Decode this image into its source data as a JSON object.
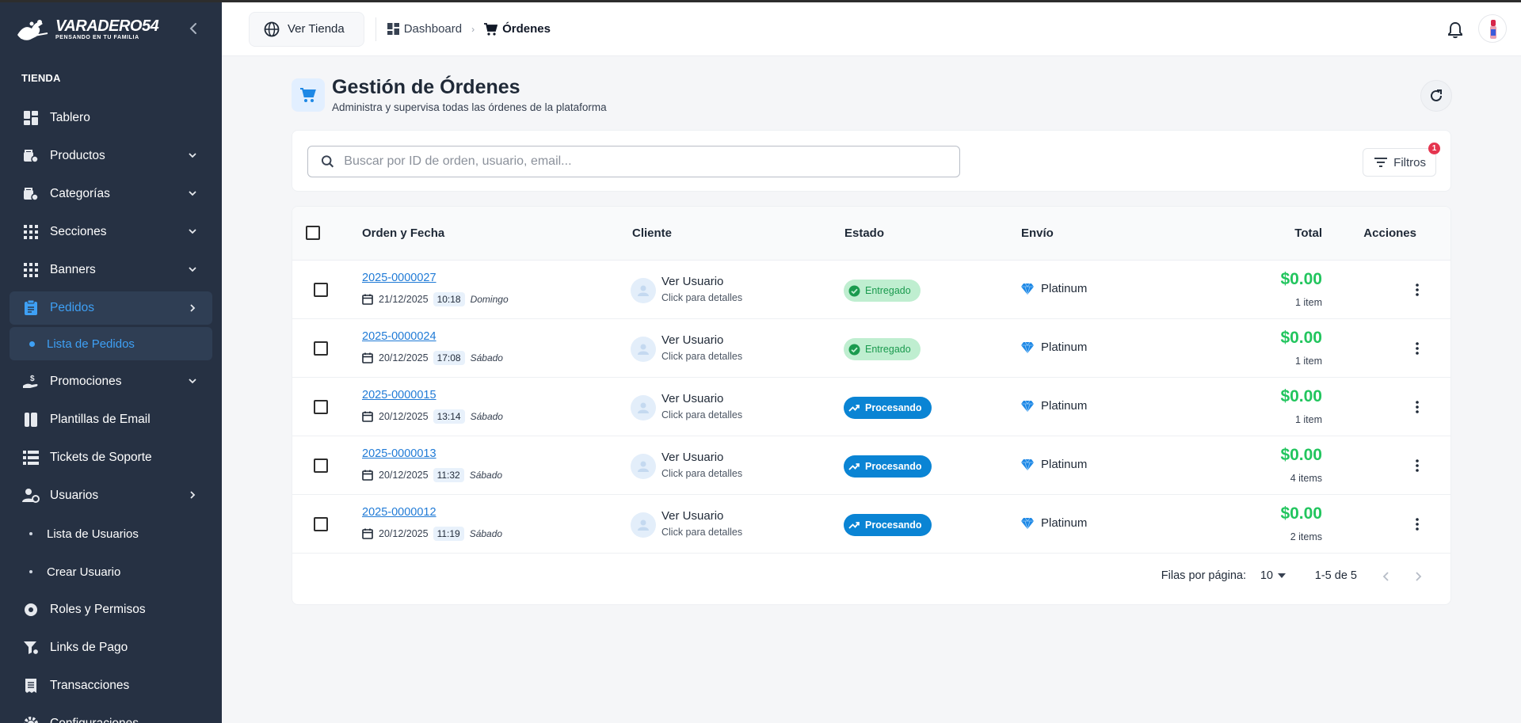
{
  "brand": {
    "name": "VARADERO54",
    "slogan": "PENSANDO EN TU FAMILIA"
  },
  "sidebar": {
    "section_label": "TIENDA",
    "items": [
      {
        "label": "Tablero",
        "icon": "dashboard-icon"
      },
      {
        "label": "Productos",
        "icon": "products-icon"
      },
      {
        "label": "Categorías",
        "icon": "categories-icon"
      },
      {
        "label": "Secciones",
        "icon": "grid-icon"
      },
      {
        "label": "Banners",
        "icon": "grid-icon"
      },
      {
        "label": "Pedidos",
        "icon": "clipboard-icon"
      },
      {
        "label": "Lista de Pedidos"
      },
      {
        "label": "Promociones",
        "icon": "money-hand-icon"
      },
      {
        "label": "Plantillas de Email",
        "icon": "template-icon"
      },
      {
        "label": "Tickets de Soporte",
        "icon": "list-icon"
      },
      {
        "label": "Usuarios",
        "icon": "user-gear-icon"
      },
      {
        "label": "Lista de Usuarios"
      },
      {
        "label": "Crear Usuario"
      },
      {
        "label": "Roles y Permisos",
        "icon": "shield-gear-icon"
      },
      {
        "label": "Links de Pago",
        "icon": "filter-icon"
      },
      {
        "label": "Transacciones",
        "icon": "receipt-icon"
      },
      {
        "label": "Configuraciones",
        "icon": "gear-icon"
      }
    ]
  },
  "header": {
    "ver_tienda": "Ver Tienda",
    "breadcrumb": [
      "Dashboard",
      "Órdenes"
    ]
  },
  "page": {
    "title": "Gestión de Órdenes",
    "subtitle": "Administra y supervisa todas las órdenes de la plataforma"
  },
  "search": {
    "placeholder": "Buscar por ID de orden, usuario, email..."
  },
  "filters": {
    "label": "Filtros",
    "badge": "1"
  },
  "table": {
    "columns": [
      "Orden y Fecha",
      "Cliente",
      "Estado",
      "Envío",
      "Total",
      "Acciones"
    ],
    "rows": [
      {
        "id": "2025-0000027",
        "date": "21/12/2025",
        "time": "10:18",
        "weekday": "Domingo",
        "client": "Ver Usuario",
        "client_sub": "Click para detalles",
        "status": "Entregado",
        "shipping": "Platinum",
        "total": "$0.00",
        "items": "1 item"
      },
      {
        "id": "2025-0000024",
        "date": "20/12/2025",
        "time": "17:08",
        "weekday": "Sábado",
        "client": "Ver Usuario",
        "client_sub": "Click para detalles",
        "status": "Entregado",
        "shipping": "Platinum",
        "total": "$0.00",
        "items": "1 item"
      },
      {
        "id": "2025-0000015",
        "date": "20/12/2025",
        "time": "13:14",
        "weekday": "Sábado",
        "client": "Ver Usuario",
        "client_sub": "Click para detalles",
        "status": "Procesando",
        "shipping": "Platinum",
        "total": "$0.00",
        "items": "1 item"
      },
      {
        "id": "2025-0000013",
        "date": "20/12/2025",
        "time": "11:32",
        "weekday": "Sábado",
        "client": "Ver Usuario",
        "client_sub": "Click para detalles",
        "status": "Procesando",
        "shipping": "Platinum",
        "total": "$0.00",
        "items": "4 items"
      },
      {
        "id": "2025-0000012",
        "date": "20/12/2025",
        "time": "11:19",
        "weekday": "Sábado",
        "client": "Ver Usuario",
        "client_sub": "Click para detalles",
        "status": "Procesando",
        "shipping": "Platinum",
        "total": "$0.00",
        "items": "2 items"
      }
    ]
  },
  "pagination": {
    "rows_per_page_label": "Filas por página:",
    "rows_per_page": "10",
    "range": "1-5 de 5"
  },
  "colors": {
    "sidebar_bg": "#263143",
    "accent": "#3ea0f5",
    "success": "#22c55e",
    "processing": "#0a84d4",
    "delivered_bg": "#bfeed0"
  }
}
